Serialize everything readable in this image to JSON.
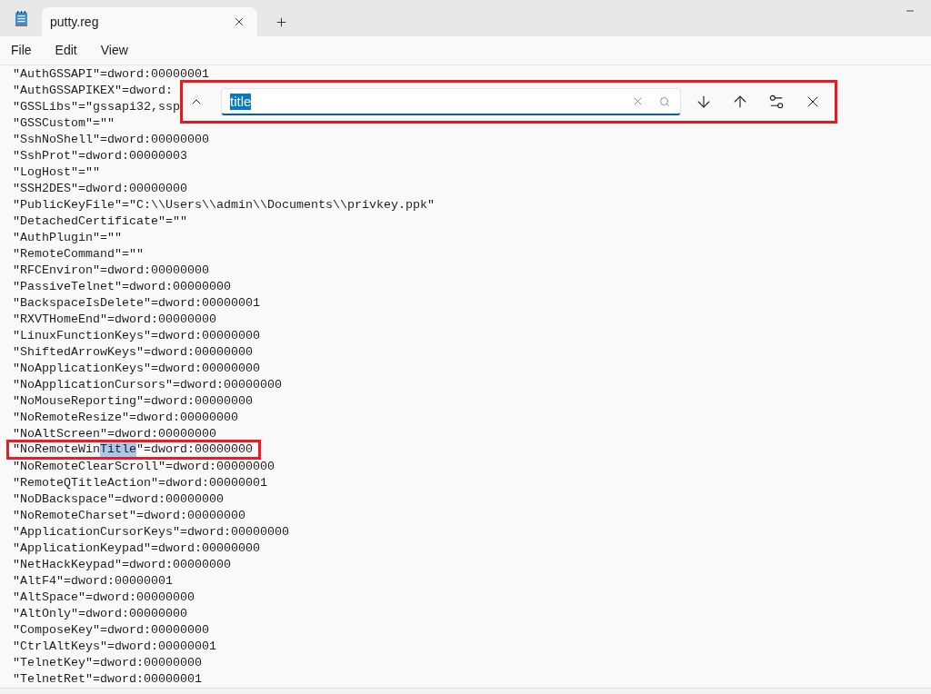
{
  "tabs": [
    {
      "label": "putty.reg",
      "selected": true
    }
  ],
  "menu": [
    "File",
    "Edit",
    "View"
  ],
  "editor": {
    "lines": [
      {
        "kind": "plain",
        "annotated": false,
        "text": "\"AuthGSSAPI\"=dword:00000001"
      },
      {
        "kind": "plain",
        "annotated": false,
        "text": "\"AuthGSSAPIKEX\"=dword:"
      },
      {
        "kind": "plain",
        "annotated": false,
        "text": "\"GSSLibs\"=\"gssapi32,ssp"
      },
      {
        "kind": "plain",
        "annotated": false,
        "text": "\"GSSCustom\"=\"\""
      },
      {
        "kind": "plain",
        "annotated": false,
        "text": "\"SshNoShell\"=dword:00000000"
      },
      {
        "kind": "plain",
        "annotated": false,
        "text": "\"SshProt\"=dword:00000003"
      },
      {
        "kind": "plain",
        "annotated": false,
        "text": "\"LogHost\"=\"\""
      },
      {
        "kind": "plain",
        "annotated": false,
        "text": "\"SSH2DES\"=dword:00000000"
      },
      {
        "kind": "plain",
        "annotated": false,
        "text": "\"PublicKeyFile\"=\"C:\\\\Users\\\\admin\\\\Documents\\\\privkey.ppk\""
      },
      {
        "kind": "plain",
        "annotated": false,
        "text": "\"DetachedCertificate\"=\"\""
      },
      {
        "kind": "plain",
        "annotated": false,
        "text": "\"AuthPlugin\"=\"\""
      },
      {
        "kind": "plain",
        "annotated": false,
        "text": "\"RemoteCommand\"=\"\""
      },
      {
        "kind": "plain",
        "annotated": false,
        "text": "\"RFCEnviron\"=dword:00000000"
      },
      {
        "kind": "plain",
        "annotated": false,
        "text": "\"PassiveTelnet\"=dword:00000000"
      },
      {
        "kind": "plain",
        "annotated": false,
        "text": "\"BackspaceIsDelete\"=dword:00000001"
      },
      {
        "kind": "plain",
        "annotated": false,
        "text": "\"RXVTHomeEnd\"=dword:00000000"
      },
      {
        "kind": "plain",
        "annotated": false,
        "text": "\"LinuxFunctionKeys\"=dword:00000000"
      },
      {
        "kind": "plain",
        "annotated": false,
        "text": "\"ShiftedArrowKeys\"=dword:00000000"
      },
      {
        "kind": "plain",
        "annotated": false,
        "text": "\"NoApplicationKeys\"=dword:00000000"
      },
      {
        "kind": "plain",
        "annotated": false,
        "text": "\"NoApplicationCursors\"=dword:00000000"
      },
      {
        "kind": "plain",
        "annotated": false,
        "text": "\"NoMouseReporting\"=dword:00000000"
      },
      {
        "kind": "plain",
        "annotated": false,
        "text": "\"NoRemoteResize\"=dword:00000000"
      },
      {
        "kind": "plain",
        "annotated": false,
        "text": "\"NoAltScreen\"=dword:00000000"
      },
      {
        "kind": "match",
        "annotated": true,
        "segments": [
          {
            "text": "\"NoRemoteWin",
            "match": false
          },
          {
            "text": "Title",
            "match": true
          },
          {
            "text": "\"=dword:00000000",
            "match": false
          }
        ]
      },
      {
        "kind": "plain",
        "annotated": false,
        "text": "\"NoRemoteClearScroll\"=dword:00000000"
      },
      {
        "kind": "plain",
        "annotated": false,
        "text": "\"RemoteQTitleAction\"=dword:00000001"
      },
      {
        "kind": "plain",
        "annotated": false,
        "text": "\"NoDBackspace\"=dword:00000000"
      },
      {
        "kind": "plain",
        "annotated": false,
        "text": "\"NoRemoteCharset\"=dword:00000000"
      },
      {
        "kind": "plain",
        "annotated": false,
        "text": "\"ApplicationCursorKeys\"=dword:00000000"
      },
      {
        "kind": "plain",
        "annotated": false,
        "text": "\"ApplicationKeypad\"=dword:00000000"
      },
      {
        "kind": "plain",
        "annotated": false,
        "text": "\"NetHackKeypad\"=dword:00000000"
      },
      {
        "kind": "plain",
        "annotated": false,
        "text": "\"AltF4\"=dword:00000001"
      },
      {
        "kind": "plain",
        "annotated": false,
        "text": "\"AltSpace\"=dword:00000000"
      },
      {
        "kind": "plain",
        "annotated": false,
        "text": "\"AltOnly\"=dword:00000000"
      },
      {
        "kind": "plain",
        "annotated": false,
        "text": "\"ComposeKey\"=dword:00000000"
      },
      {
        "kind": "plain",
        "annotated": false,
        "text": "\"CtrlAltKeys\"=dword:00000001"
      },
      {
        "kind": "plain",
        "annotated": false,
        "text": "\"TelnetKey\"=dword:00000000"
      },
      {
        "kind": "plain",
        "annotated": false,
        "text": "\"TelnetRet\"=dword:00000001"
      }
    ]
  },
  "find_bar": {
    "annotated": true,
    "query": "title",
    "query_selected": true
  }
}
